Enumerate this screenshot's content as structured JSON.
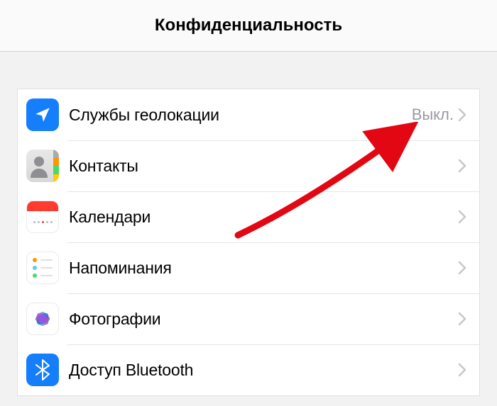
{
  "header": {
    "title": "Конфиденциальность"
  },
  "rows": {
    "location": {
      "label": "Службы геолокации",
      "value": "Выкл."
    },
    "contacts": {
      "label": "Контакты"
    },
    "calendar": {
      "label": "Календари"
    },
    "reminders": {
      "label": "Напоминания"
    },
    "photos": {
      "label": "Фотографии"
    },
    "bluetooth": {
      "label": "Доступ Bluetooth"
    }
  }
}
